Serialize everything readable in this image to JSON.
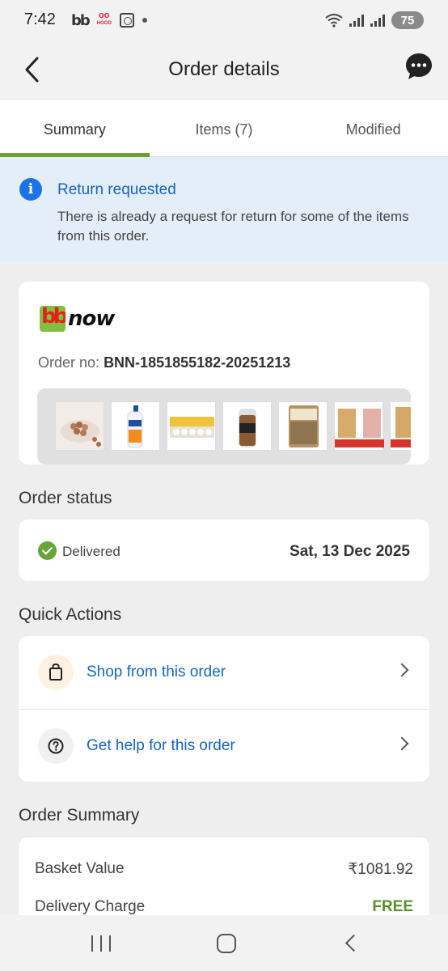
{
  "status_bar": {
    "time": "7:42",
    "battery": "75",
    "app_icons": [
      "bb-icon",
      "hood-icon",
      "scan-icon"
    ],
    "hood_label": "HOOD"
  },
  "header": {
    "title": "Order details"
  },
  "tabs": [
    {
      "label": "Summary",
      "active": true
    },
    {
      "label": "Items (7)",
      "active": false
    },
    {
      "label": "Modified",
      "active": false
    }
  ],
  "notice": {
    "icon": "info-icon",
    "title": "Return requested",
    "text": "There is already a request for return for some of the items from this order."
  },
  "order": {
    "brand_logo": "bbnow-logo",
    "order_no_label": "Order no:",
    "order_no": "BNN-1851855182-20251213",
    "thumbnails": [
      "chana-bowl",
      "shampoo-bottle",
      "egg-tray",
      "bread-loaf",
      "grain-pack",
      "flour-pack-duo",
      "flour-pack"
    ]
  },
  "order_status": {
    "section_title": "Order status",
    "status": "Delivered",
    "date": "Sat, 13 Dec 2025"
  },
  "quick_actions": {
    "section_title": "Quick Actions",
    "items": [
      {
        "label": "Shop from this order",
        "icon": "shopping-bag-icon"
      },
      {
        "label": "Get help for this order",
        "icon": "help-icon"
      }
    ]
  },
  "order_summary": {
    "section_title": "Order Summary",
    "rows": [
      {
        "label": "Basket Value",
        "value": "₹1081.92"
      },
      {
        "label": "Delivery Charge",
        "value": "FREE"
      }
    ]
  },
  "colors": {
    "accent_green": "#6c9e32",
    "link_blue": "#1565c0",
    "info_blue": "#1a73e8",
    "notice_bg": "#e4eef9"
  }
}
